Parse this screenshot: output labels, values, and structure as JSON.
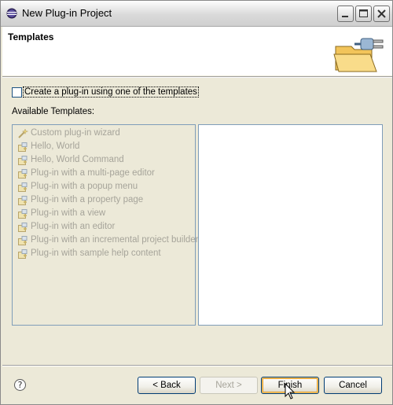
{
  "window": {
    "title": "New Plug-in Project"
  },
  "header": {
    "title": "Templates",
    "graphic": "folder-plug-icon"
  },
  "checkbox": {
    "label": "Create a plug-in using one of the templates",
    "checked": false
  },
  "available_label": "Available Templates:",
  "templates": [
    {
      "label": "Custom plug-in wizard",
      "icon": "wizard-icon"
    },
    {
      "label": "Hello, World",
      "icon": "template-icon"
    },
    {
      "label": "Hello, World Command",
      "icon": "template-icon"
    },
    {
      "label": "Plug-in with a multi-page editor",
      "icon": "template-icon"
    },
    {
      "label": "Plug-in with a popup menu",
      "icon": "template-icon"
    },
    {
      "label": "Plug-in with a property page",
      "icon": "template-icon"
    },
    {
      "label": "Plug-in with a view",
      "icon": "template-icon"
    },
    {
      "label": "Plug-in with an editor",
      "icon": "template-icon"
    },
    {
      "label": "Plug-in with an incremental project builder",
      "icon": "template-icon"
    },
    {
      "label": "Plug-in with sample help content",
      "icon": "template-icon"
    }
  ],
  "buttons": {
    "back": "< Back",
    "next": "Next >",
    "finish": "Finish",
    "cancel": "Cancel"
  },
  "help_icon": "?",
  "colors": {
    "disabled_text": "#a6a49a",
    "accent_border": "#003c74",
    "focus_highlight": "#e4a132"
  }
}
